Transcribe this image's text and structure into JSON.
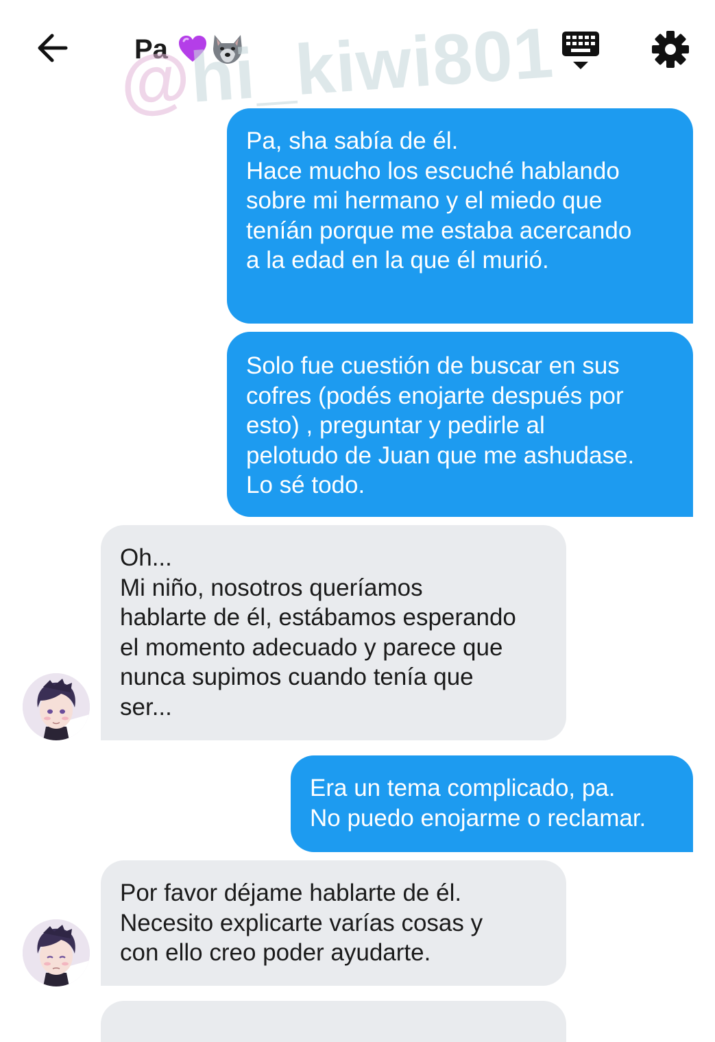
{
  "header": {
    "title": "Pa",
    "title_emojis": [
      "purple-heart",
      "wolf-face"
    ],
    "back_icon": "arrow-left-icon",
    "keyboard_icon": "keyboard-icon",
    "settings_icon": "gear-icon"
  },
  "watermark": {
    "prefix": "@",
    "rest": "hi_kiwi801"
  },
  "messages": [
    {
      "direction": "outgoing",
      "text": "Pa, sha sabía de él.\nHace mucho los escuché hablando\nsobre mi hermano y el miedo que\nteníán porque me estaba acercando\na la edad en la que él murió."
    },
    {
      "direction": "outgoing",
      "text": "Solo fue cuestión de buscar en sus\ncofres (podés enojarte después por\nesto) , preguntar y pedirle al\npelotudo de Juan que me ashudase.\nLo sé todo."
    },
    {
      "direction": "incoming",
      "text": "Oh...\nMi niño, nosotros queríamos\nhablarte de él, estábamos esperando\nel momento adecuado y parece que\nnunca supimos cuando tenía que\nser..."
    },
    {
      "direction": "outgoing",
      "text": "Era un tema complicado, pa.\nNo puedo enojarme o reclamar."
    },
    {
      "direction": "incoming",
      "text": "Por favor déjame hablarte de él.\nNecesito explicarte varías cosas y\ncon ello creo poder ayudarte."
    }
  ],
  "colors": {
    "outgoing_bubble": "#1d9bf0",
    "incoming_bubble": "#e9ebee",
    "background": "#ffffff"
  }
}
